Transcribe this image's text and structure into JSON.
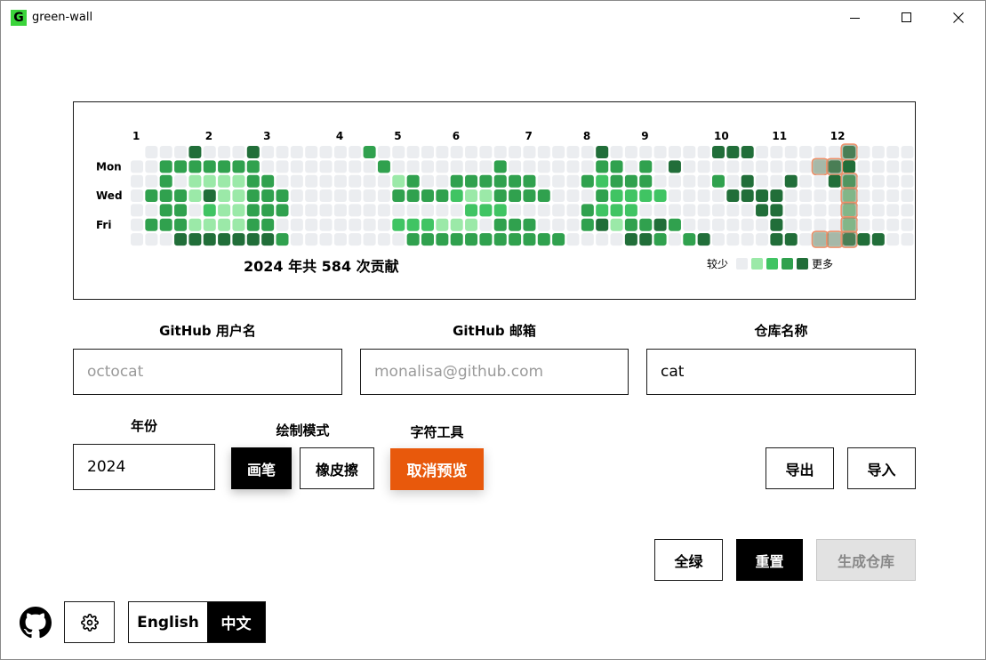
{
  "window": {
    "title": "green-wall",
    "icon_letter": "G"
  },
  "graph": {
    "months": [
      "1",
      "2",
      "3",
      "4",
      "5",
      "6",
      "7",
      "8",
      "9",
      "10",
      "11",
      "12"
    ],
    "weekdays": [
      "Mon",
      "Wed",
      "Fri"
    ],
    "total_text": "2024 年共 584 次贡献",
    "legend_less": "较少",
    "legend_more": "更多",
    "colors": {
      "level0": "#ebedf0",
      "level1": "#9be9a8",
      "level2": "#40c463",
      "level3": "#30a14e",
      "level4": "#216e39",
      "highlight": "#f0906a"
    },
    "rows": [
      "0000400040000000300000000000000040000000444000000400000",
      "0033333330000000030000000300000033030400000000004400000",
      "0030111133000000001300333333000323330000304004004300000",
      "0333141133300000003333211333300032222000044440000100000",
      "0033021133300000000000022200000322200000000440000100000",
      "0333111133000000002221110333000341334300000040000100000",
      "0004444444300000000333333333330000443034000044000444000"
    ],
    "highlight_rows": [
      "0000000000000000000000000000000000000000000000000100000",
      "0000000000000000000000000000000000000000000000011000000",
      "0000000000000000000000000000000000000000000000000100000",
      "0000000000000000000000000000000000000000000000000100000",
      "0000000000000000000000000000000000000000000000000100000",
      "0000000000000000000000000000000000000000000000000100000",
      "0000000000000000000000000000000000000000000000011100000"
    ]
  },
  "form": {
    "username_label": "GitHub 用户名",
    "username_placeholder": "octocat",
    "email_label": "GitHub 邮箱",
    "email_placeholder": "monalisa@github.com",
    "repo_label": "仓库名称",
    "repo_value": "cat",
    "year_label": "年份",
    "year_value": "2024",
    "draw_mode_label": "绘制模式",
    "pen_label": "画笔",
    "eraser_label": "橡皮擦",
    "char_tool_label": "字符工具",
    "cancel_preview_label": "取消预览",
    "export_label": "导出",
    "import_label": "导入"
  },
  "actions": {
    "all_green_label": "全绿",
    "reset_label": "重置",
    "generate_label": "生成仓库"
  },
  "footer": {
    "lang_en": "English",
    "lang_zh": "中文",
    "active_lang": "zh"
  }
}
